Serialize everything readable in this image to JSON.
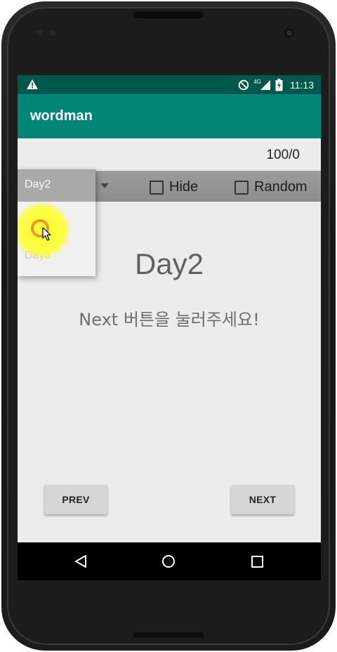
{
  "status_bar": {
    "time": "11:13",
    "network": "4G",
    "icons": [
      "warning-icon",
      "do-not-disturb-icon",
      "signal-icon",
      "battery-charging-icon"
    ]
  },
  "app_bar": {
    "title": "wordman"
  },
  "score": "100/0",
  "day_spinner": {
    "selected": "Day2",
    "options_visible": [
      "Day2",
      "Day3"
    ]
  },
  "options": {
    "hide_label": "Hide",
    "hide_checked": false,
    "random_label": "Random",
    "random_checked": false
  },
  "main": {
    "day_title": "Day2",
    "instruction": "Next 버튼을 눌러주세요!"
  },
  "buttons": {
    "prev_label": "PREV",
    "next_label": "NEXT"
  },
  "colors": {
    "status_bar": "#00574b",
    "app_bar": "#008577",
    "content_bg": "#ececec",
    "touch_indicator": "#ffff28",
    "touch_ring": "#f39326"
  },
  "nav_bar": {
    "icons": [
      "back-icon",
      "home-icon",
      "recents-icon"
    ]
  }
}
